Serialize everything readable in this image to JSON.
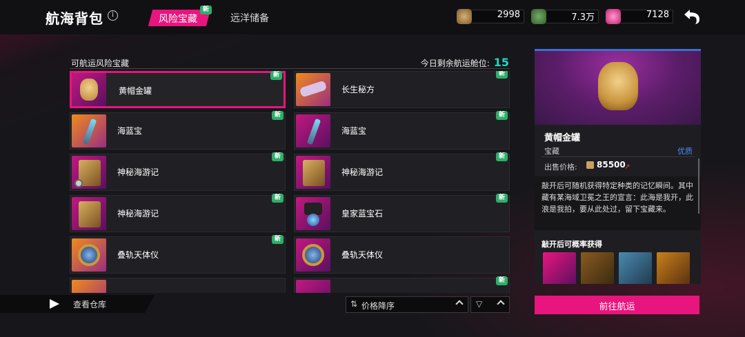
{
  "header": {
    "title": "航海背包",
    "tabs": [
      {
        "label": "风险宝藏",
        "active": true,
        "badge": "新"
      },
      {
        "label": "远洋储备",
        "active": false
      }
    ],
    "currencies": [
      {
        "icon": "gold-ore-icon",
        "value": "2998"
      },
      {
        "icon": "treasure-coin-icon",
        "value": "7.3万"
      },
      {
        "icon": "pink-gem-icon",
        "value": "7128"
      }
    ]
  },
  "list": {
    "title": "可航运风险宝藏",
    "remaining_label": "今日剩余航运舱位:",
    "remaining_value": "15",
    "items": [
      {
        "name": "黄帽金罐",
        "badge": "新",
        "selected": true
      },
      {
        "name": "长生秘方",
        "badge": "新"
      },
      {
        "name": "海蓝宝",
        "badge": "新"
      },
      {
        "name": "海蓝宝",
        "badge": "新"
      },
      {
        "name": "神秘海游记",
        "badge": "新"
      },
      {
        "name": "神秘海游记",
        "badge": "新"
      },
      {
        "name": "神秘海游记",
        "badge": "新"
      },
      {
        "name": "皇家蓝宝石",
        "badge": "新"
      },
      {
        "name": "叠轨天体仪",
        "badge": "新"
      },
      {
        "name": "叠轨天体仪",
        "badge": ""
      },
      {
        "name": "",
        "badge": ""
      },
      {
        "name": "",
        "badge": "新"
      }
    ]
  },
  "footer": {
    "warehouse_label": "查看仓库",
    "sort_label": "价格降序"
  },
  "detail": {
    "name": "黄帽金罐",
    "type": "宝藏",
    "quality": "优质",
    "price_label": "出售价格:",
    "price_value": "85500",
    "description": "敲开后可随机获得特定种类的记忆瞬间。其中藏有某海域卫冕之王的宣言：此海是我开，此浪是我拍，要从此处过，留下宝藏来。",
    "drops_title": "敲开后可概率获得",
    "action_label": "前往航运"
  },
  "colors": {
    "accent": "#e8157e",
    "new_badge": "#2fae6a",
    "remaining": "#26d6c2",
    "quality": "#4a8cf7"
  }
}
